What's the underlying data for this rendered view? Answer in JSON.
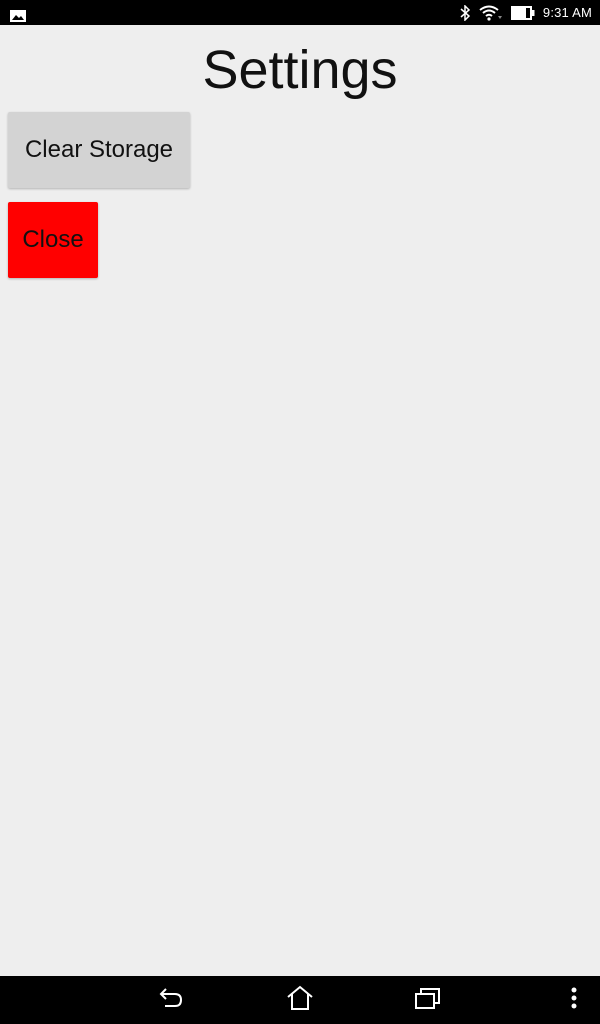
{
  "status_bar": {
    "time": "9:31 AM",
    "left_icon": "image-notification-icon",
    "icons": [
      "bluetooth-icon",
      "wifi-icon",
      "battery-icon"
    ]
  },
  "page": {
    "title": "Settings"
  },
  "buttons": {
    "clear_storage_label": "Clear Storage",
    "close_label": "Close"
  },
  "colors": {
    "background": "#eeeeee",
    "clear_button": "#d3d3d3",
    "close_button": "#ff0000",
    "system_bars": "#000000"
  },
  "nav_bar": {
    "icons": [
      "back-icon",
      "home-icon",
      "recents-icon",
      "overflow-menu-icon"
    ]
  }
}
